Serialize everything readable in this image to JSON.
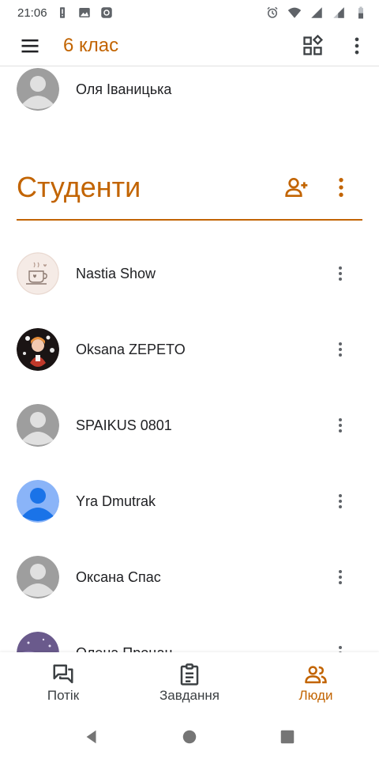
{
  "status_bar": {
    "time": "21:06"
  },
  "app_bar": {
    "title": "6 клас"
  },
  "teacher": {
    "name": "Оля Іваницька"
  },
  "section": {
    "title": "Студенти"
  },
  "students": [
    {
      "name": "Nastia Show",
      "avatar": "cup-avatar"
    },
    {
      "name": "Oksana ZEPETO",
      "avatar": "photo-avatar"
    },
    {
      "name": "SPAIKUS 0801",
      "avatar": "default-avatar"
    },
    {
      "name": "Yra Dmutrak",
      "avatar": "blue-avatar"
    },
    {
      "name": "Оксана Спас",
      "avatar": "default-avatar"
    },
    {
      "name": "Олена Процан",
      "avatar": "photo-avatar"
    }
  ],
  "bottom_nav": {
    "items": [
      {
        "label": "Потік",
        "icon": "stream-icon"
      },
      {
        "label": "Завдання",
        "icon": "classwork-icon"
      },
      {
        "label": "Люди",
        "icon": "people-icon",
        "active": true
      }
    ]
  },
  "colors": {
    "accent": "#c26401",
    "avatar_gray": "#9e9e9e",
    "avatar_blue": "#8ab4f8"
  }
}
